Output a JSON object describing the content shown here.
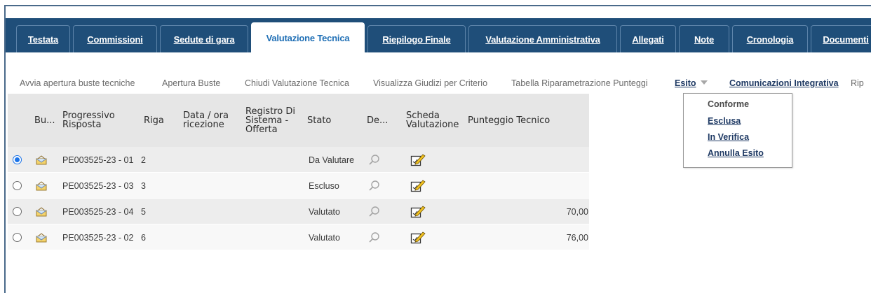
{
  "tabs": [
    {
      "label": "Testata",
      "active": false
    },
    {
      "label": "Commissioni",
      "active": false
    },
    {
      "label": "Sedute di gara",
      "active": false
    },
    {
      "label": "Valutazione Tecnica",
      "active": true
    },
    {
      "label": "Riepilogo Finale",
      "active": false
    },
    {
      "label": "Valutazione Amministrativa",
      "active": false
    },
    {
      "label": "Allegati",
      "active": false
    },
    {
      "label": "Note",
      "active": false
    },
    {
      "label": "Cronologia",
      "active": false
    },
    {
      "label": "Documenti",
      "active": false
    }
  ],
  "toolbar": {
    "avvia": "Avvia apertura buste tecniche",
    "apertura": "Apertura Buste",
    "chiudi": "Chiudi Valutazione Tecnica",
    "visualizza": "Visualizza Giudizi per Criterio",
    "tabella": "Tabella Riparametrazione Punteggi",
    "esito": "Esito",
    "comunicazioni": "Comunicazioni Integrativa",
    "rip": "Rip"
  },
  "esito_menu": {
    "items": [
      "Conforme",
      "Esclusa",
      "In Verifica",
      "Annulla Esito"
    ]
  },
  "table": {
    "headers": {
      "busta": "Bu...",
      "progressivo_1": "Progressivo",
      "progressivo_2": "Risposta",
      "riga": "Riga",
      "data_1": "Data / ora",
      "data_2": "ricezione",
      "registro_1": "Registro Di",
      "registro_2": "Sistema -",
      "registro_3": "Offerta",
      "stato": "Stato",
      "dettaglio": "De...",
      "scheda_1": "Scheda",
      "scheda_2": "Valutazione",
      "punteggio": "Punteggio Tecnico"
    },
    "rows": [
      {
        "selected": true,
        "progressivo": "PE003525-23 - 01",
        "riga": "2",
        "stato": "Da Valutare",
        "punteggio": ""
      },
      {
        "selected": false,
        "progressivo": "PE003525-23 - 03",
        "riga": "3",
        "stato": "Escluso",
        "punteggio": ""
      },
      {
        "selected": false,
        "progressivo": "PE003525-23 - 04",
        "riga": "5",
        "stato": "Valutato",
        "punteggio": "70,00"
      },
      {
        "selected": false,
        "progressivo": "PE003525-23 - 02",
        "riga": "6",
        "stato": "Valutato",
        "punteggio": "76,00"
      }
    ]
  },
  "icons": {
    "busta": "envelope-icon",
    "dettaglio": "magnifier-icon",
    "scheda": "edit-sheet-icon"
  },
  "colors": {
    "tab_bar": "#1f4e79",
    "active_tab_text": "#1f6fb5",
    "link": "#1f3a64",
    "radio_selected": "#1a73e8"
  }
}
